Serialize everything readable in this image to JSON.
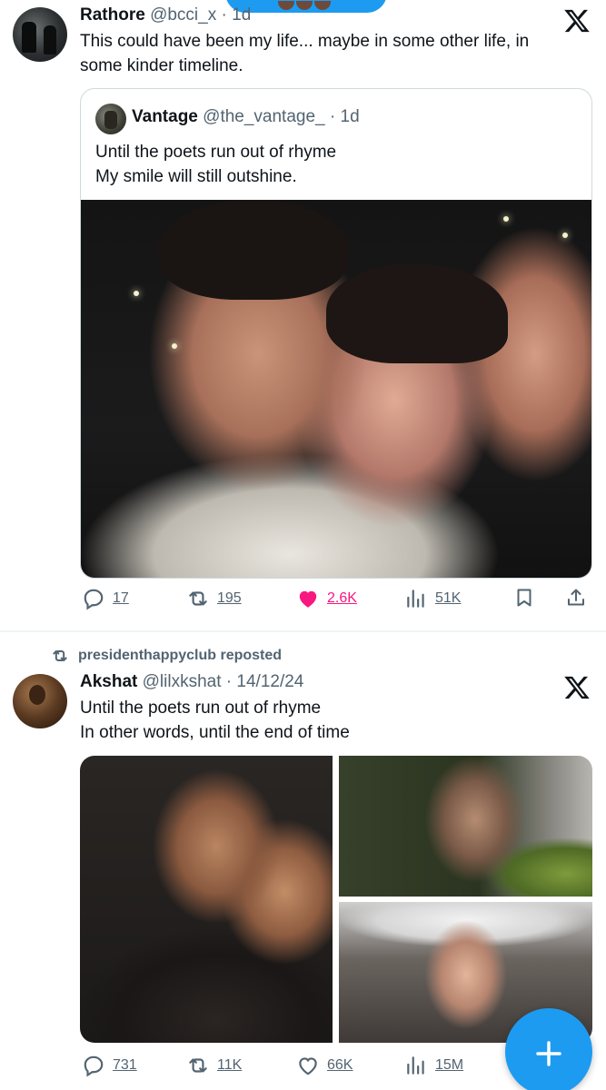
{
  "post1": {
    "author_name": "Rathore",
    "author_handle": "@bcci_x",
    "time": "· 1d",
    "text": "This could have been my life... maybe in some other life, in\nsome kinder timeline.",
    "quote": {
      "author_name": "Vantage",
      "author_handle": "@the_vantage_",
      "time": "· 1d",
      "text": "Until the poets run out of rhyme\nMy smile will still outshine."
    },
    "actions": {
      "replies": "17",
      "reposts": "195",
      "likes": "2.6K",
      "views": "51K"
    }
  },
  "post2": {
    "repost_by": "presidenthappyclub reposted",
    "author_name": "Akshat",
    "author_handle": "@lilxkshat",
    "time": "· 14/12/24",
    "text": "Until the poets run out of rhyme\nIn other words, until the end of time",
    "actions": {
      "replies": "731",
      "reposts": "11K",
      "likes": "66K",
      "views": "15M"
    }
  },
  "icons": {
    "reply": "reply-icon",
    "repost": "repost-icon",
    "like": "heart-icon",
    "views": "views-chart-icon",
    "bookmark": "bookmark-icon",
    "share": "share-icon",
    "x_logo": "x-logo-icon",
    "compose": "plus-icon"
  },
  "colors": {
    "accent": "#1d9bf0",
    "like": "#f91880",
    "muted": "#536471"
  }
}
